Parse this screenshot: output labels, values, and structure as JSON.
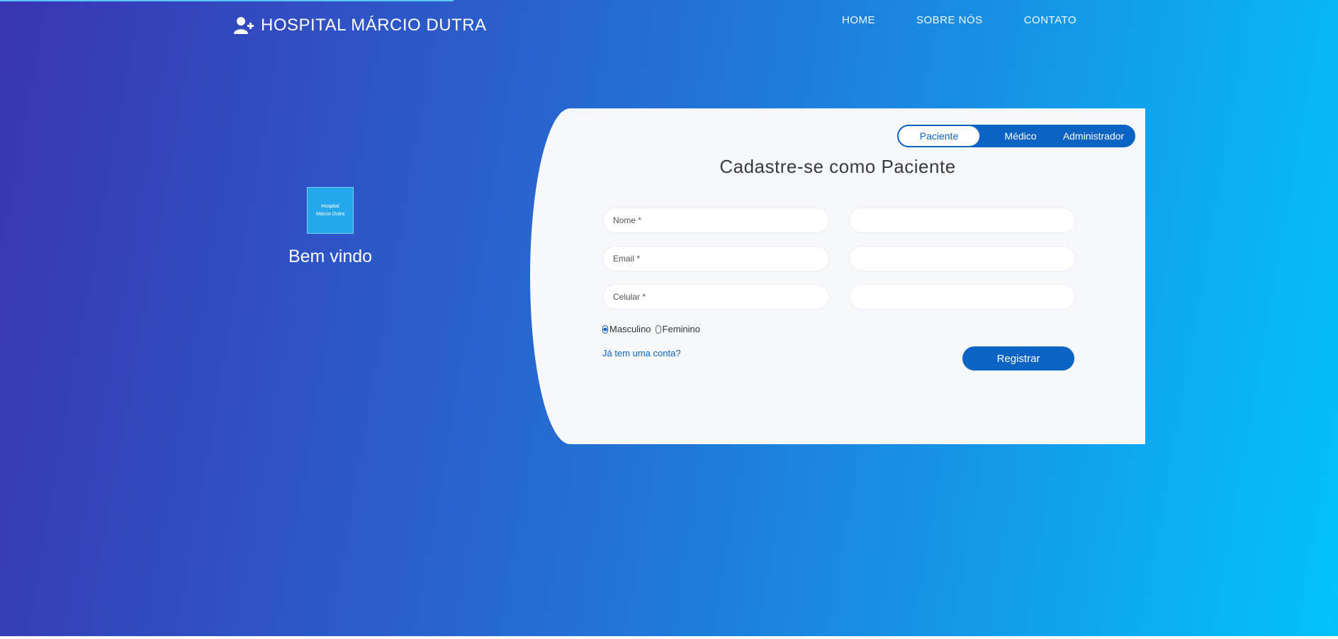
{
  "app": {
    "brand": "HOSPITAL MÁRCIO DUTRA",
    "brand_icon": "user-plus-icon"
  },
  "nav": {
    "items": [
      {
        "label": "HOME"
      },
      {
        "label": "SOBRE NÓS"
      },
      {
        "label": "CONTATO"
      }
    ]
  },
  "welcome": {
    "logo_text": [
      "Hospital",
      "Márcio Dutra"
    ],
    "heading": "Bem vindo"
  },
  "card": {
    "tabs": [
      {
        "label": "Paciente",
        "active": true
      },
      {
        "label": "Médico",
        "active": false
      },
      {
        "label": "Administrador",
        "active": false
      }
    ],
    "title": "Cadastre-se como Paciente",
    "fields": [
      {
        "placeholder": "Nome *",
        "value": ""
      },
      {
        "placeholder": "",
        "value": ""
      },
      {
        "placeholder": "Email *",
        "value": ""
      },
      {
        "placeholder": "",
        "value": ""
      },
      {
        "placeholder": "Celular *",
        "value": ""
      },
      {
        "placeholder": "",
        "value": ""
      }
    ],
    "gender": {
      "options": [
        "Masculino",
        "Feminino"
      ],
      "selected": "Masculino"
    },
    "already_link": "Já tem uma conta?",
    "register_label": "Registrar"
  },
  "colors": {
    "accent": "#0b63c3",
    "gradient_start": "#3a35b2",
    "gradient_end": "#03c3fb",
    "card_bg": "#f6f8fb"
  }
}
